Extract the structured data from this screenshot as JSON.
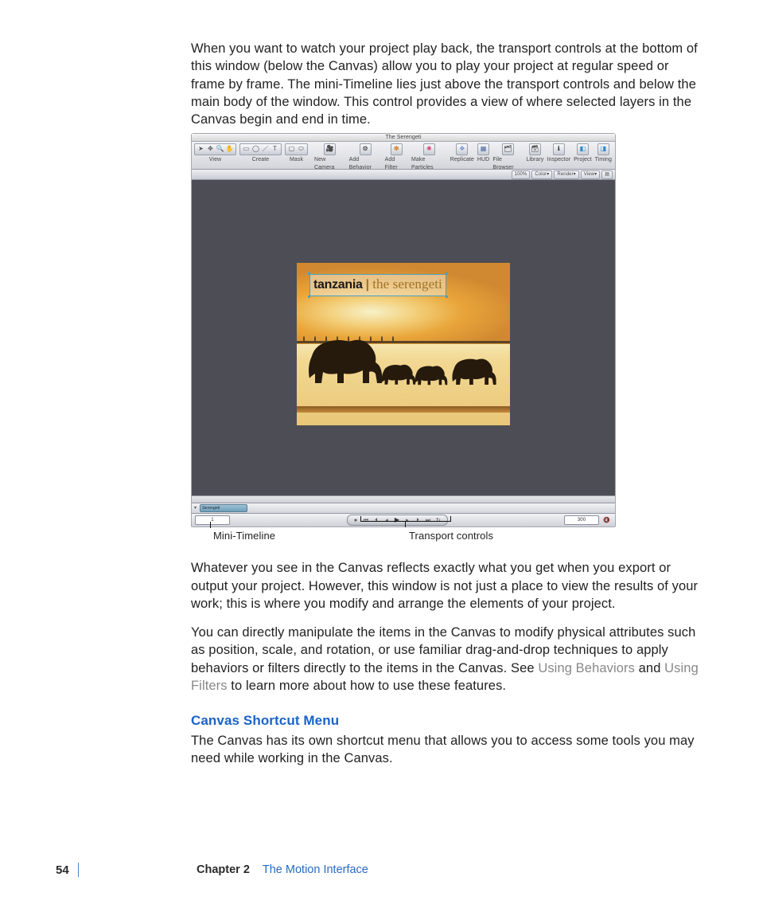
{
  "paragraphs": {
    "p1": "When you want to watch your project play back, the transport controls at the bottom of this window (below the Canvas) allow you to play your project at regular speed or frame by frame. The mini-Timeline lies just above the transport controls and below the main body of the window. This control provides a view of where selected layers in the Canvas begin and end in time.",
    "p2": "Whatever you see in the Canvas reflects exactly what you get when you export or output your project. However, this window is not just a place to view the results of your work; this is where you modify and arrange the elements of your project.",
    "p3a": "You can directly manipulate the items in the Canvas to modify physical attributes such as position, scale, and rotation, or use familiar drag-and-drop techniques to apply behaviors or filters directly to the items in the Canvas. See ",
    "link1": "Using Behaviors",
    "p3b": " and ",
    "link2": "Using Filters",
    "p3c": " to learn more about how to use these features.",
    "heading": "Canvas Shortcut Menu",
    "p4": "The Canvas has its own shortcut menu that allows you to access some tools you may need while working in the Canvas."
  },
  "figure": {
    "windowTitle": "The Serengeti",
    "toolbar": {
      "groups": {
        "view": "View",
        "create": "Create",
        "mask": "Mask"
      },
      "right": {
        "newCamera": "New Camera",
        "addBehavior": "Add Behavior",
        "addFilter": "Add Filter",
        "makeParticles": "Make Particles",
        "replicate": "Replicate",
        "hud": "HUD",
        "fileBrowser": "File Browser",
        "library": "Library",
        "inspector": "Inspector",
        "project": "Project",
        "timing": "Timing"
      }
    },
    "viewOptions": {
      "zoom": "100%",
      "color": "Color",
      "render": "Render",
      "view": "View"
    },
    "canvas": {
      "titleMain": "tanzania",
      "titleBar": "|",
      "titleSub": "the serengeti"
    },
    "miniClip": "Serengeti",
    "timecodeLeft": "1",
    "timecodeRight": "300",
    "callouts": {
      "miniTimeline": "Mini-Timeline",
      "transport": "Transport controls"
    }
  },
  "footer": {
    "pageNo": "54",
    "chapterLabel": "Chapter 2",
    "chapterTitle": "The Motion Interface"
  }
}
